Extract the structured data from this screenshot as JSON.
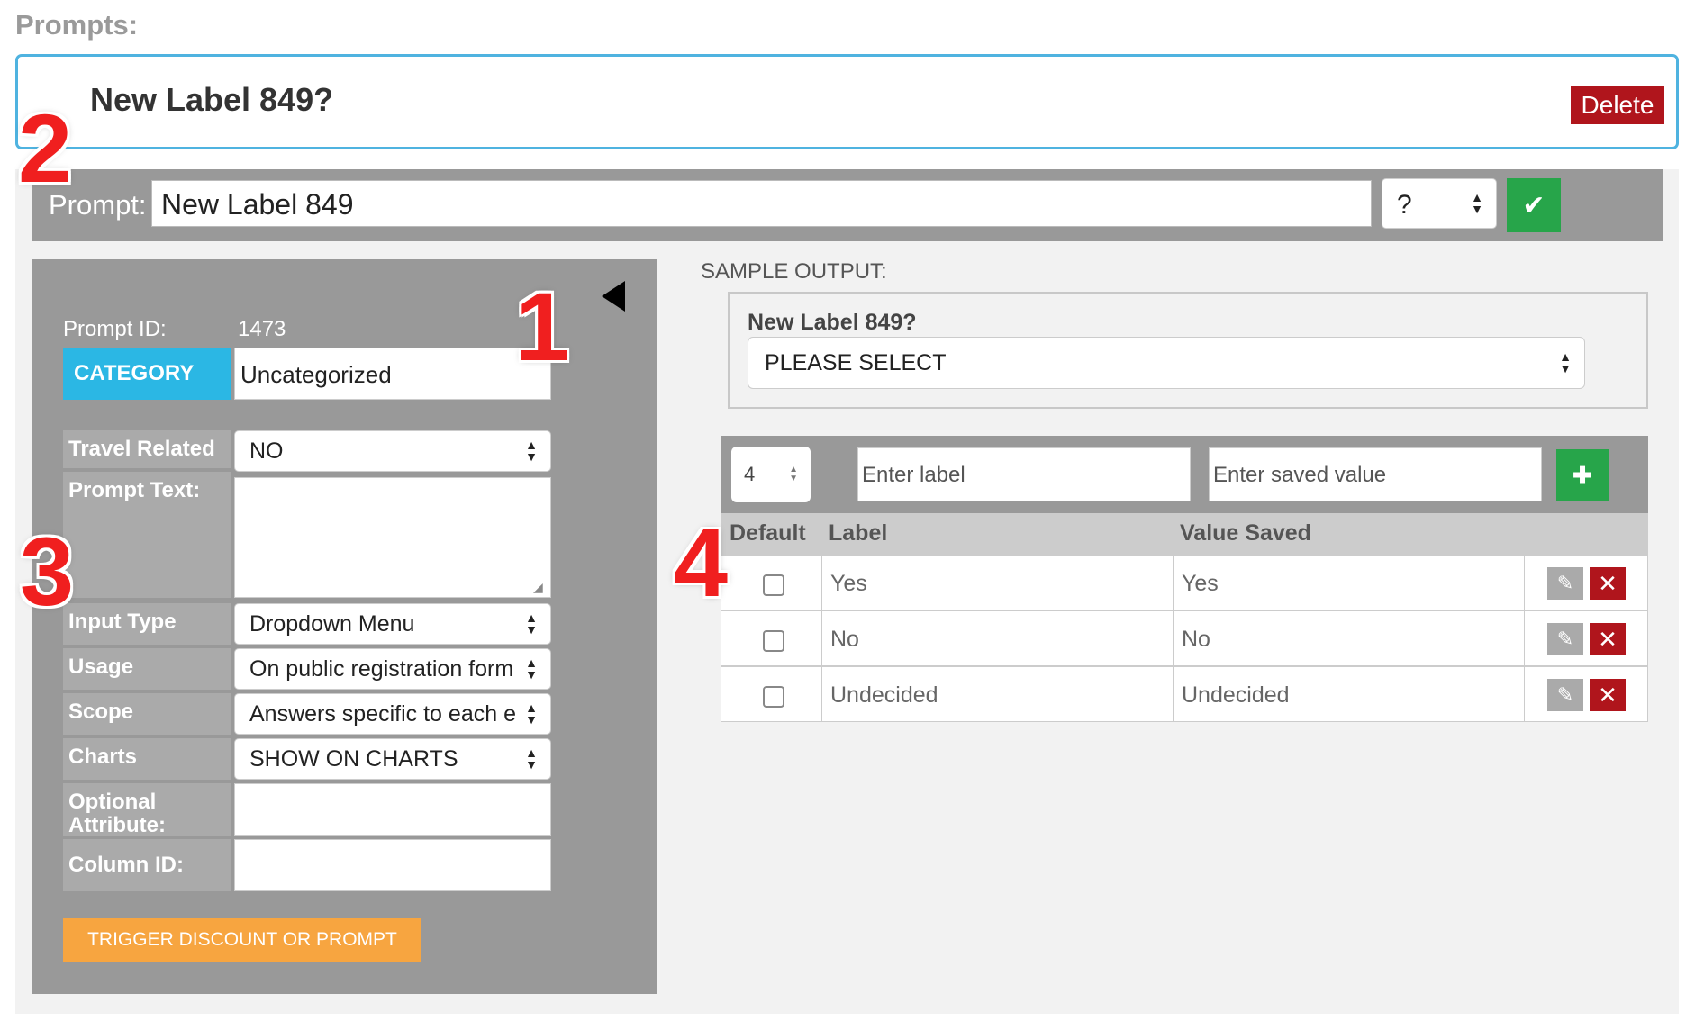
{
  "header": {
    "heading": "Prompts:"
  },
  "prompt_card": {
    "title": "New Label 849?",
    "delete_label": "Delete"
  },
  "annotations": {
    "a1": "1",
    "a2": "2",
    "a3": "3",
    "a4": "4"
  },
  "prompt_bar": {
    "label": "Prompt:",
    "value": "New Label 849",
    "suffix_select": "?",
    "save_icon": "checkmark-icon"
  },
  "details": {
    "prompt_id_label": "Prompt ID:",
    "prompt_id_value": "1473",
    "category_button": "CATEGORY",
    "category_value": "Uncategorized",
    "fields": [
      {
        "label": "Travel Related",
        "value": "NO"
      },
      {
        "label": "Prompt Text:",
        "value": ""
      },
      {
        "label": "Input Type",
        "value": "Dropdown Menu"
      },
      {
        "label": "Usage",
        "value": "On public registration form"
      },
      {
        "label": "Scope",
        "value": "Answers specific to each e"
      },
      {
        "label": "Charts",
        "value": "SHOW ON CHARTS"
      },
      {
        "label": "Optional Attribute:",
        "value": ""
      },
      {
        "label": "Column ID:",
        "value": ""
      }
    ],
    "trigger_button": "TRIGGER DISCOUNT OR PROMPT"
  },
  "sample_output": {
    "label": "SAMPLE OUTPUT:",
    "question": "New Label 849?",
    "select_value": "PLEASE SELECT"
  },
  "options_editor": {
    "order_value": "4",
    "label_placeholder": "Enter label",
    "value_placeholder": "Enter saved value",
    "add_icon": "plus-icon",
    "columns": [
      "Default",
      "Label",
      "Value Saved"
    ],
    "rows": [
      {
        "label": "Yes",
        "value": "Yes",
        "default": false
      },
      {
        "label": "No",
        "value": "No",
        "default": false
      },
      {
        "label": "Undecided",
        "value": "Undecided",
        "default": false
      }
    ],
    "edit_icon": "pencil-icon",
    "delete_icon": "close-icon"
  },
  "colors": {
    "accent_blue": "#2bb7e4",
    "danger": "#b0151c",
    "success": "#27a54a",
    "warning": "#f7a540",
    "panel_gray": "#999999"
  }
}
